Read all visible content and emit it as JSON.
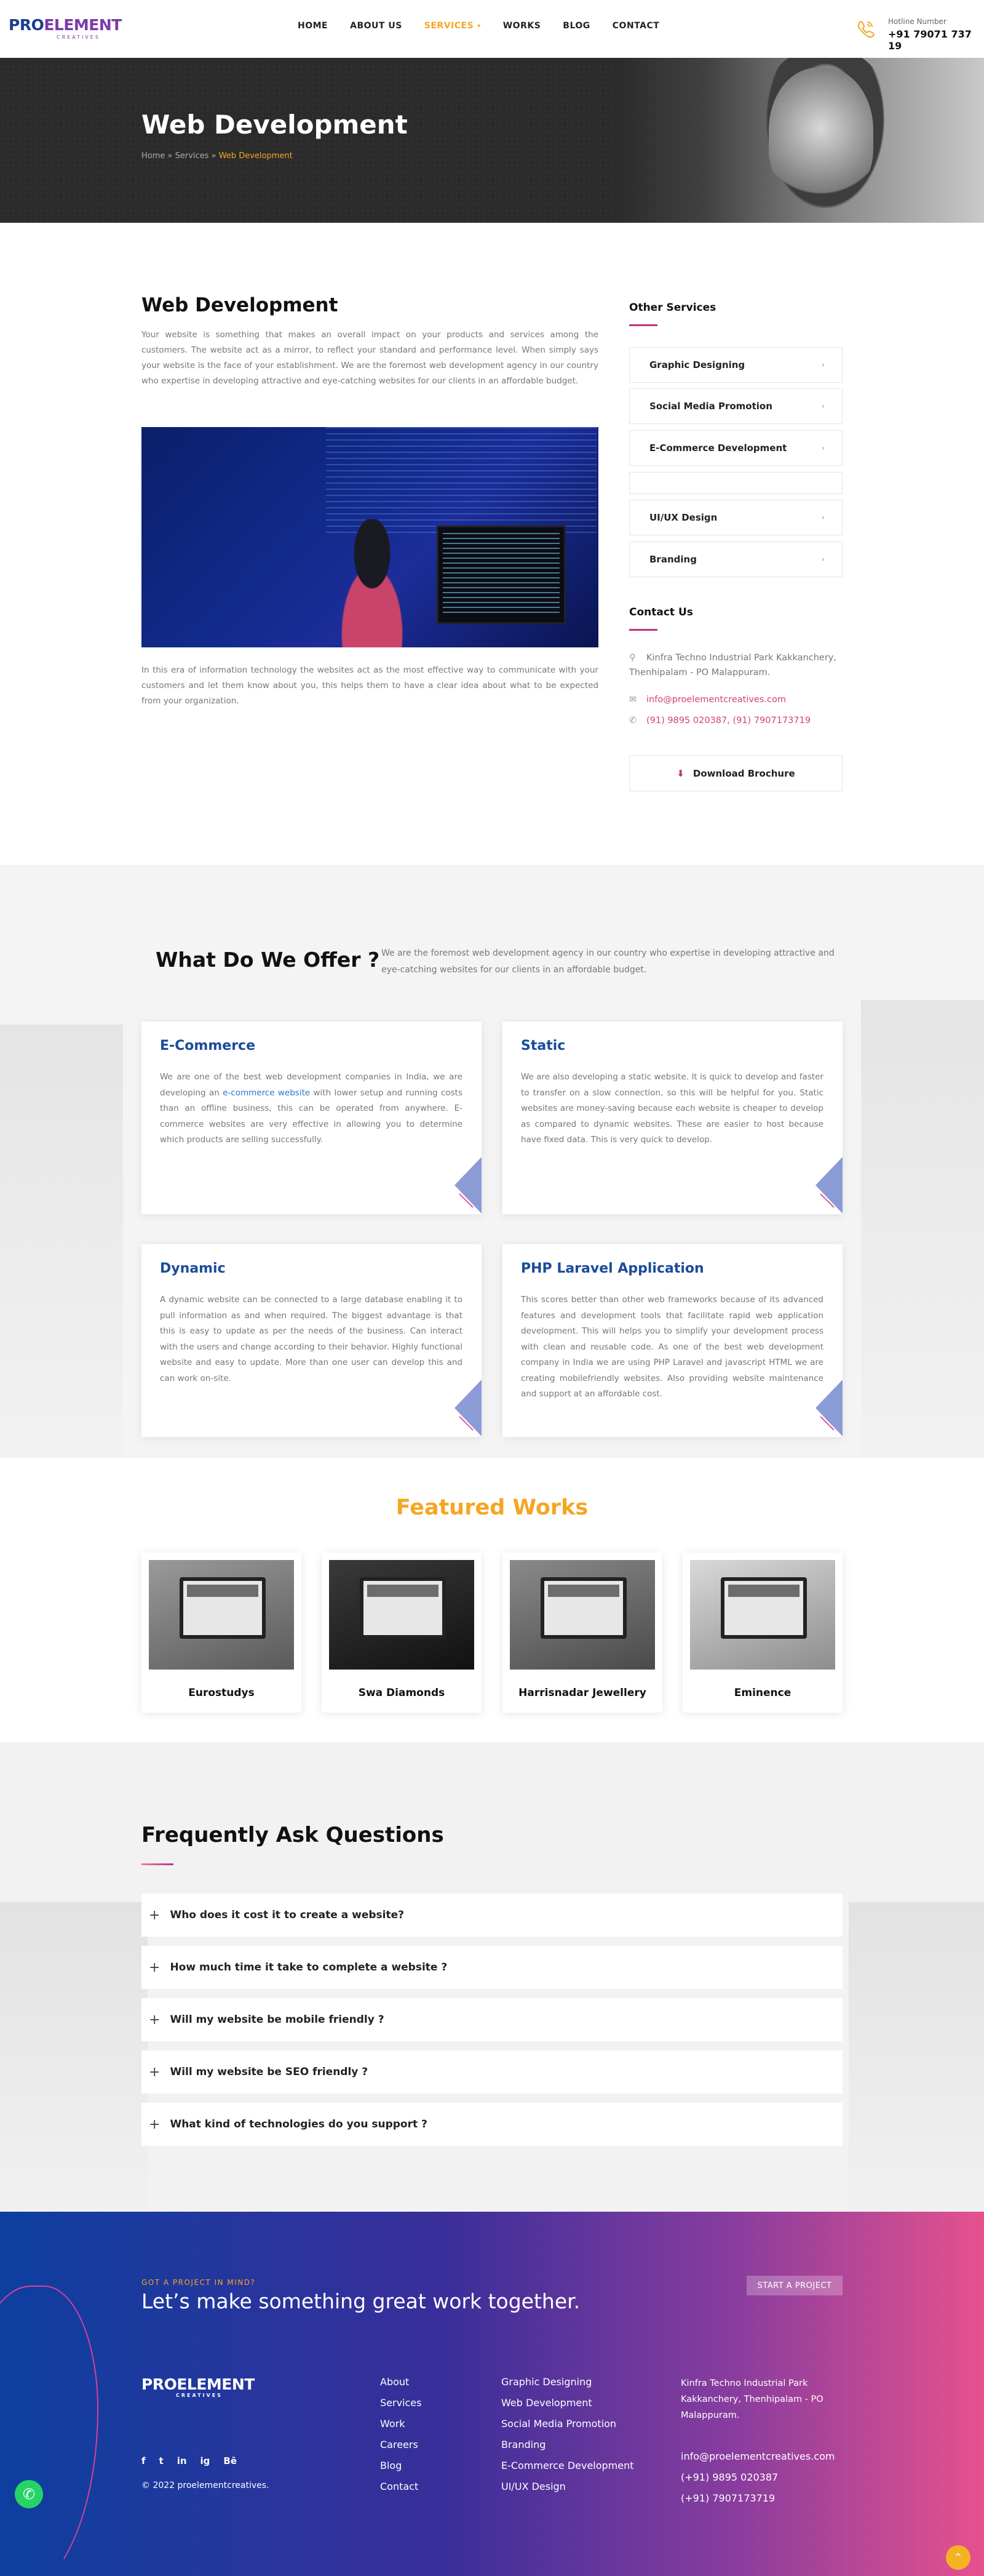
{
  "brand": {
    "logo_left": "PRO",
    "logo_right": "ELEMENT",
    "logo_sub": "CREATIVES"
  },
  "nav": {
    "home": "HOME",
    "about": "ABOUT US",
    "services": "SERVICES",
    "works": "WORKS",
    "blog": "BLOG",
    "contact": "CONTACT"
  },
  "hotline": {
    "label": "Hotline Number",
    "number": "+91 79071 737 19"
  },
  "banner": {
    "title": "Web Development",
    "crumb_home": "Home",
    "crumb_sep": "»",
    "crumb_services": "Services",
    "crumb_current": "Web Development"
  },
  "main": {
    "title": "Web Development",
    "intro": "Your website is something that makes an overall impact on your products and services among the customers. The website act as a mirror, to reflect your standard and performance level. When simply says your website is the face of your establishment. We are the foremost web development agency in our country who expertise in developing attractive and eye-catching websites for our clients in an affordable budget.",
    "body": "In this era of information technology the websites act as the most effective way to communicate with your customers and let them know about you, this helps them to have a clear idea about what to be expected from your organization."
  },
  "sidebar": {
    "other_services_title": "Other Services",
    "services": [
      "Graphic Designing",
      "Social Media Promotion",
      "E-Commerce Development",
      "",
      "UI/UX Design",
      "Branding"
    ],
    "contact_title": "Contact Us",
    "address": "Kinfra Techno Industrial Park Kakkanchery, Thenhipalam - PO Malappuram.",
    "email": "info@proelementcreatives.com",
    "phones": "(91) 9895 020387, (91) 7907173719",
    "download_label": "Download Brochure"
  },
  "offer": {
    "title": "What Do We Offer ?",
    "desc": "We are the foremost web development agency in our country who expertise in developing attractive and eye-catching websites for our clients in an affordable budget.",
    "cards": [
      {
        "title": "E-Commerce",
        "text_a": "We are one of the best web development companies in India, we are developing an ",
        "link": "e-commerce website",
        "text_b": " with lower setup and running costs than an offline business, this can be operated from anywhere. E-commerce websites are very effective in allowing you to determine which products are selling successfully."
      },
      {
        "title": "Static",
        "text_a": "We are also developing a static website. It is quick to develop and faster to transfer on a slow connection, so this will be helpful for you. Static websites are money-saving because each website is cheaper to develop as compared to dynamic websites. These are easier to host because have fixed data. This is very quick to develop.",
        "link": "",
        "text_b": ""
      },
      {
        "title": "Dynamic",
        "text_a": "A dynamic website can be connected to a large database enabling it to pull information as and when required. The biggest advantage is that this is easy to update as per the needs of the business. Can interact with the users and change according to their behavior. Highly functional website and easy to update. More than one user can develop this and can work on-site.",
        "link": "",
        "text_b": ""
      },
      {
        "title": "PHP Laravel Application",
        "text_a": "This scores better than other web frameworks because of its advanced features and development tools that facilitate rapid web application development. This will helps you to simplify your development process with clean and reusable code. As one of the best web development company in India we are using PHP Laravel and javascript HTML we are creating mobilefriendly websites. Also providing website maintenance and support at an affordable cost.",
        "link": "",
        "text_b": ""
      }
    ]
  },
  "featured": {
    "title": "Featured Works",
    "works": [
      "Eurostudys",
      "Swa Diamonds",
      "Harrisnadar Jewellery",
      "Eminence"
    ]
  },
  "faq": {
    "title": "Frequently Ask Questions",
    "items": [
      "Who does it cost it to create a website?",
      "How much time it take to complete a website ?",
      "Will my website be mobile friendly ?",
      "Will my website be SEO friendly ?",
      "What kind of technologies do you support ?"
    ]
  },
  "footer": {
    "kicker": "GOT A PROJECT IN MIND?",
    "headline": "Let’s make something great work together.",
    "cta": "START A PROJECT",
    "logo_left": "PRO",
    "logo_right": "ELEMENT",
    "logo_sub": "CREATIVES",
    "social": [
      "f",
      "t",
      "in",
      "ig",
      "Bē"
    ],
    "copyright": "© 2022 proelementcreatives.",
    "links_col1": [
      "About",
      "Services",
      "Work",
      "Careers",
      "Blog",
      "Contact"
    ],
    "links_col2": [
      "Graphic Designing",
      "Web Development",
      "Social Media Promotion",
      "Branding",
      "E-Commerce Development",
      "UI/UX Design"
    ],
    "address": "Kinfra Techno Industrial Park Kakkanchery, Thenhipalam - PO Malappuram.",
    "email": "info@proelementcreatives.com",
    "phone1": "(+91) 9895 020387",
    "phone2": "(+91) 7907173719"
  },
  "colors": {
    "accent": "#f5a623",
    "brand_pink": "#c2317e",
    "brand_blue": "#1a4c9b"
  }
}
